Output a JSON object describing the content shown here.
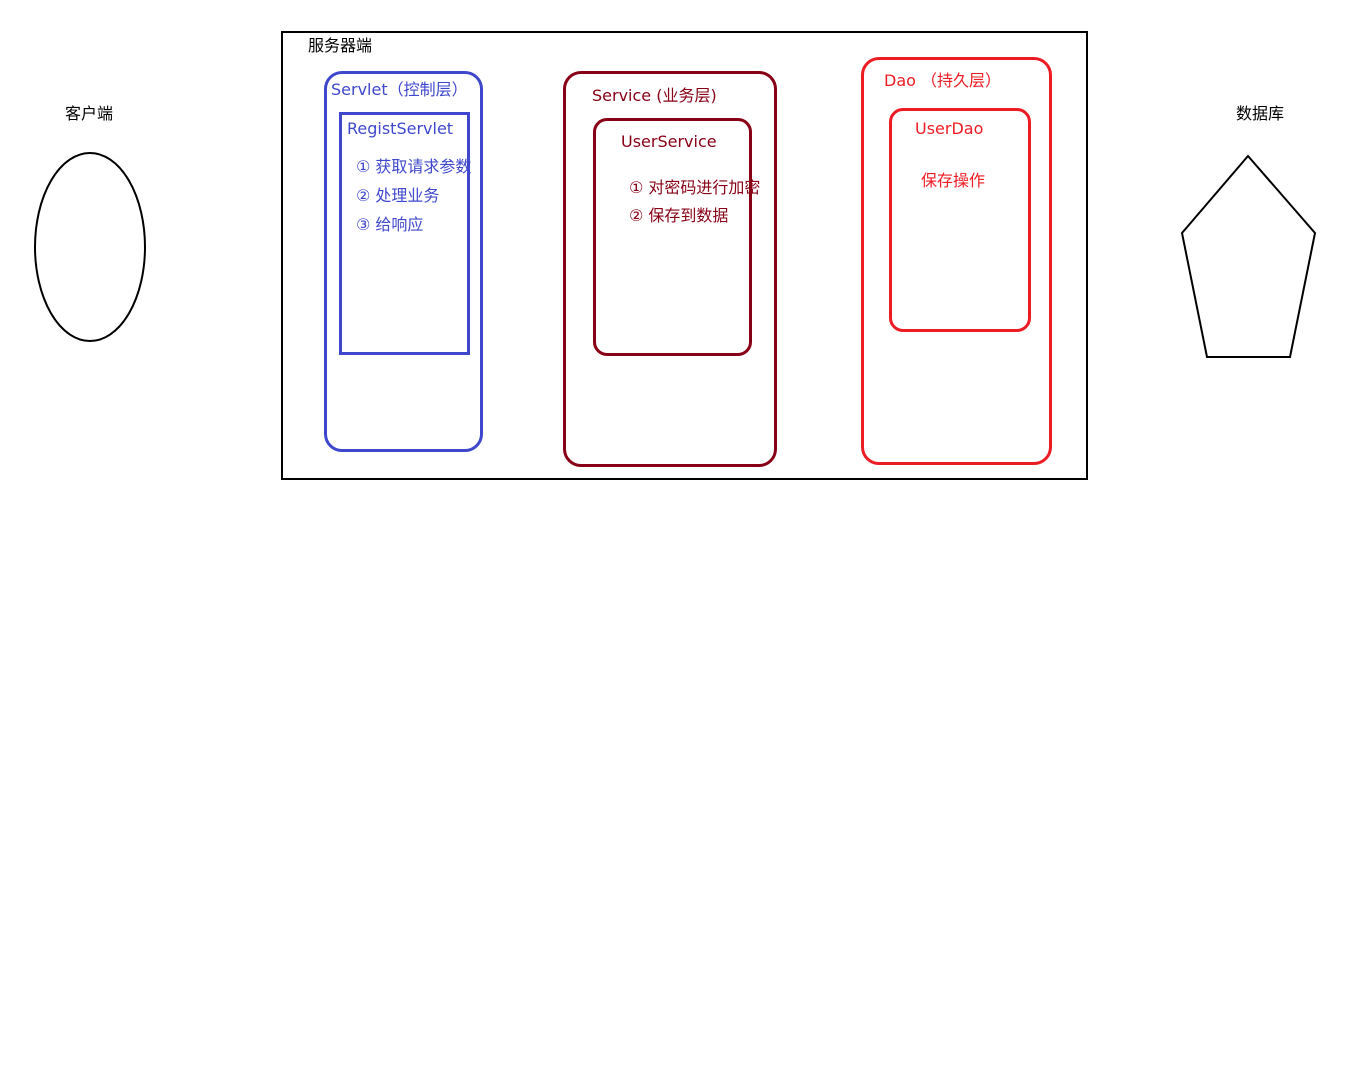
{
  "client": {
    "label": "客户端"
  },
  "database": {
    "label": "数据库"
  },
  "server": {
    "label": "服务器端",
    "servlet_layer": {
      "label": "Servlet（控制层）",
      "component": {
        "name": "RegistServlet",
        "steps": [
          "① 获取请求参数",
          "② 处理业务",
          "③ 给响应"
        ]
      }
    },
    "service_layer": {
      "label": "Service (业务层)",
      "component": {
        "name": "UserService",
        "steps": [
          "① 对密码进行加密",
          "② 保存到数据"
        ]
      }
    },
    "dao_layer": {
      "label": "Dao （持久层）",
      "component": {
        "name": "UserDao",
        "steps": [
          "保存操作"
        ]
      }
    }
  },
  "colors": {
    "servlet": "#3f48cc",
    "service": "#880015",
    "dao": "#ed1c24",
    "outline": "#000000"
  }
}
